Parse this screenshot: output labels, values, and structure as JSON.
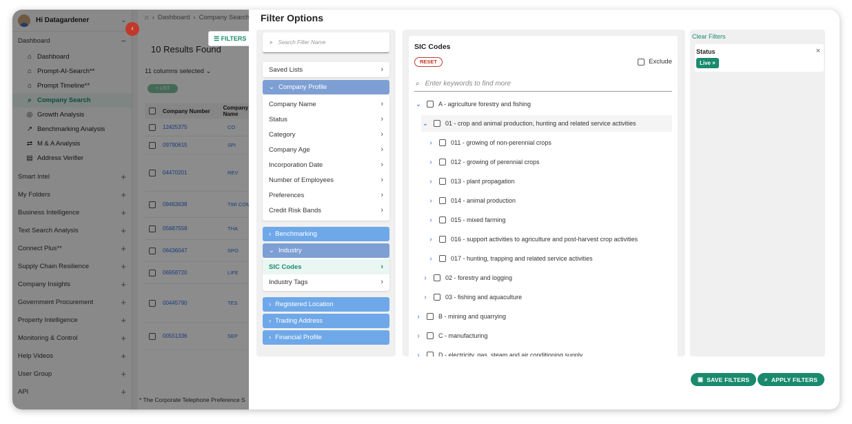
{
  "sidebar": {
    "user_name": "Hi Datagardener",
    "dashboard_section": "Dashboard",
    "dashboard_items": [
      {
        "label": "Dashboard",
        "icon": "home-icon"
      },
      {
        "label": "Prompt-AI-Search**",
        "icon": "home-icon"
      },
      {
        "label": "Prompt Timeline**",
        "icon": "home-icon"
      },
      {
        "label": "Company Search",
        "icon": "search-icon"
      },
      {
        "label": "Growth Analysis",
        "icon": "growth-icon"
      },
      {
        "label": "Benchmarking Analysis",
        "icon": "trend-icon"
      },
      {
        "label": "M & A Analysis",
        "icon": "merge-icon"
      },
      {
        "label": "Address Verifier",
        "icon": "document-icon"
      }
    ],
    "sections": [
      "Smart Intel",
      "My Folders",
      "Business Intelligence",
      "Text Search Analysis",
      "Connect Plus**",
      "Supply Chain Resilience",
      "Company Insights",
      "Government Procurement",
      "Property Intelligence",
      "Monitoring & Control",
      "Help Videos",
      "User Group",
      "API"
    ]
  },
  "main": {
    "breadcrumb": [
      "Dashboard",
      "Company Search"
    ],
    "results_label": "10 Results Found",
    "filters_button": "FILTERS",
    "columns_selected": "11 columns selected",
    "list_pill": "+ LIST",
    "table_headers": [
      "Company Number",
      "Company Name"
    ],
    "rows": [
      {
        "number": "12425375",
        "name": "CO"
      },
      {
        "number": "09790615",
        "name": "SPI"
      },
      {
        "number": "04470201",
        "name": "REV"
      },
      {
        "number": "09463638",
        "name": "TWI COMPA"
      },
      {
        "number": "05687558",
        "name": "THA"
      },
      {
        "number": "06436047",
        "name": "SPO"
      },
      {
        "number": "06958720",
        "name": "LIFE"
      },
      {
        "number": "00445790",
        "name": "TES"
      },
      {
        "number": "00551336",
        "name": "SEP"
      }
    ],
    "footnote": "* The Corporate Telephone Preference S"
  },
  "filter_panel": {
    "title": "Filter Options",
    "search_placeholder": "Search Filter Name",
    "saved_lists": "Saved Lists",
    "company_profile": "Company Profile",
    "company_profile_items": [
      "Company Name",
      "Status",
      "Category",
      "Company Age",
      "Incorporation Date",
      "Number of Employees",
      "Preferences",
      "Credit Risk Bands"
    ],
    "benchmarking": "Benchmarking",
    "industry": "Industry",
    "industry_items": [
      "SIC Codes",
      "Industry Tags"
    ],
    "more_sections": [
      "Registered Location",
      "Trading Address",
      "Financial Profile"
    ],
    "sic": {
      "title": "SIC Codes",
      "reset": "RESET",
      "exclude": "Exclude",
      "keyword_placeholder": "Enter keywords to find more",
      "tree": [
        {
          "label": "A - agriculture forestry and fishing",
          "level": 0,
          "toggle": "expanded"
        },
        {
          "label": "01 - crop and animal production, hunting and related service activities",
          "level": 1,
          "toggle": "expanded"
        },
        {
          "label": "011 - growing of non-perennial crops",
          "level": 2,
          "toggle": "collapsed"
        },
        {
          "label": "012 - growing of perennial crops",
          "level": 2,
          "toggle": "collapsed"
        },
        {
          "label": "013 - plant propagation",
          "level": 2,
          "toggle": "collapsed"
        },
        {
          "label": "014 - animal production",
          "level": 2,
          "toggle": "collapsed"
        },
        {
          "label": "015 - mixed farming",
          "level": 2,
          "toggle": "collapsed"
        },
        {
          "label": "016 - support activities to agriculture and post-harvest crop activities",
          "level": 2,
          "toggle": "collapsed"
        },
        {
          "label": "017 - hunting, trapping and related service activities",
          "level": 2,
          "toggle": "collapsed"
        },
        {
          "label": "02 - forestry and logging",
          "level": 1,
          "toggle": "collapsed"
        },
        {
          "label": "03 - fishing and aquaculture",
          "level": 1,
          "toggle": "collapsed"
        },
        {
          "label": "B - mining and quarrying",
          "level": 0,
          "toggle": "collapsed"
        },
        {
          "label": "C - manufacturing",
          "level": 0,
          "toggle": "collapsed"
        },
        {
          "label": "D - electricity, gas, steam and air conditioning supply",
          "level": 0,
          "toggle": "collapsed"
        }
      ]
    },
    "applied": {
      "clear_filters": "Clear Filters",
      "status_title": "Status",
      "status_chip": "Live ×"
    },
    "save_filters": "SAVE FILTERS",
    "apply_filters": "APPLY FILTERS"
  },
  "colors": {
    "accent": "#1a8a6e",
    "accordion_blue": "#6fa8e8",
    "reset_red": "#c0392b",
    "link_blue": "#2d6cdf"
  }
}
